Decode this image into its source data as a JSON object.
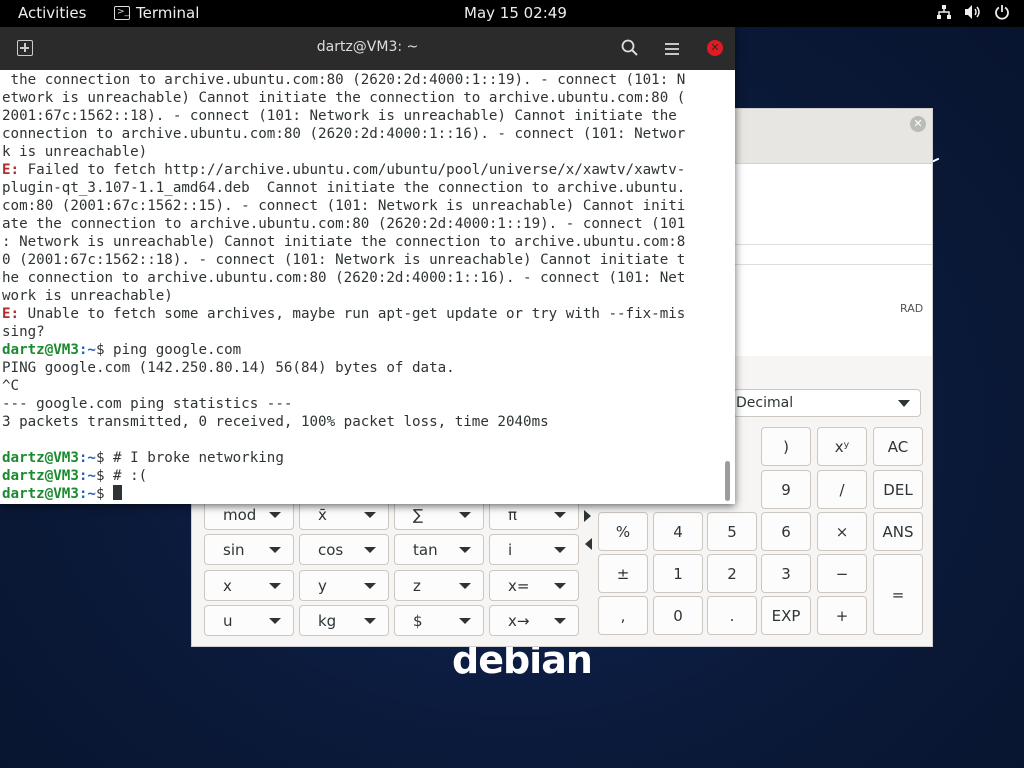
{
  "topbar": {
    "activities": "Activities",
    "app_name": "Terminal",
    "clock": "May 15  02:49"
  },
  "desktop": {
    "logo_text": "debian"
  },
  "terminal": {
    "title": "dartz@VM3: ~",
    "lines": [
      {
        "type": "text",
        "text": " the connection to archive.ubuntu.com:80 (2620:2d:4000:1::19). - connect (101: N"
      },
      {
        "type": "text",
        "text": "etwork is unreachable) Cannot initiate the connection to archive.ubuntu.com:80 ("
      },
      {
        "type": "text",
        "text": "2001:67c:1562::18). - connect (101: Network is unreachable) Cannot initiate the"
      },
      {
        "type": "text",
        "text": "connection to archive.ubuntu.com:80 (2620:2d:4000:1::16). - connect (101: Networ"
      },
      {
        "type": "text",
        "text": "k is unreachable)"
      },
      {
        "type": "error",
        "prefix": "E:",
        "text": " Failed to fetch http://archive.ubuntu.com/ubuntu/pool/universe/x/xawtv/xawtv-"
      },
      {
        "type": "text",
        "text": "plugin-qt_3.107-1.1_amd64.deb  Cannot initiate the connection to archive.ubuntu."
      },
      {
        "type": "text",
        "text": "com:80 (2001:67c:1562::15). - connect (101: Network is unreachable) Cannot initi"
      },
      {
        "type": "text",
        "text": "ate the connection to archive.ubuntu.com:80 (2620:2d:4000:1::19). - connect (101"
      },
      {
        "type": "text",
        "text": ": Network is unreachable) Cannot initiate the connection to archive.ubuntu.com:8"
      },
      {
        "type": "text",
        "text": "0 (2001:67c:1562::18). - connect (101: Network is unreachable) Cannot initiate t"
      },
      {
        "type": "text",
        "text": "he connection to archive.ubuntu.com:80 (2620:2d:4000:1::16). - connect (101: Net"
      },
      {
        "type": "text",
        "text": "work is unreachable)"
      },
      {
        "type": "error",
        "prefix": "E:",
        "text": " Unable to fetch some archives, maybe run apt-get update or try with --fix-mis"
      },
      {
        "type": "text",
        "text": "sing?"
      },
      {
        "type": "prompt",
        "user": "dartz@VM3",
        "path": ":~",
        "text": "$ ping google.com"
      },
      {
        "type": "text",
        "text": "PING google.com (142.250.80.14) 56(84) bytes of data."
      },
      {
        "type": "text",
        "text": "^C"
      },
      {
        "type": "text",
        "text": "--- google.com ping statistics ---"
      },
      {
        "type": "text",
        "text": "3 packets transmitted, 0 received, 100% packet loss, time 2040ms"
      },
      {
        "type": "text",
        "text": ""
      },
      {
        "type": "prompt",
        "user": "dartz@VM3",
        "path": ":~",
        "text": "$ # I broke networking"
      },
      {
        "type": "prompt",
        "user": "dartz@VM3",
        "path": ":~",
        "text": "$ # :("
      },
      {
        "type": "prompt-cursor",
        "user": "dartz@VM3",
        "path": ":~",
        "text": "$ "
      }
    ]
  },
  "calculator": {
    "angle_unit": "RAD",
    "mode": "Decimal",
    "function_buttons": [
      {
        "label": "mod",
        "name": "mod-button"
      },
      {
        "label": "x̄",
        "name": "mean-button"
      },
      {
        "label": "∑",
        "name": "sum-button"
      },
      {
        "label": "π",
        "name": "pi-button"
      },
      {
        "label": "sin",
        "name": "sin-button"
      },
      {
        "label": "cos",
        "name": "cos-button"
      },
      {
        "label": "tan",
        "name": "tan-button"
      },
      {
        "label": "i",
        "name": "imaginary-button"
      },
      {
        "label": "x",
        "name": "var-x-button"
      },
      {
        "label": "y",
        "name": "var-y-button"
      },
      {
        "label": "z",
        "name": "var-z-button"
      },
      {
        "label": "x=",
        "name": "assign-button"
      },
      {
        "label": "u",
        "name": "unit-button"
      },
      {
        "label": "kg",
        "name": "kg-button"
      },
      {
        "label": "$",
        "name": "currency-button"
      },
      {
        "label": "x→",
        "name": "convert-button"
      }
    ],
    "keypad": [
      {
        "label": ")",
        "name": "close-paren-button"
      },
      {
        "label": "xʸ",
        "name": "power-button"
      },
      {
        "label": "AC",
        "name": "all-clear-button"
      },
      {
        "label": "9",
        "name": "digit-9-button"
      },
      {
        "label": "/",
        "name": "divide-button"
      },
      {
        "label": "DEL",
        "name": "delete-button"
      },
      {
        "label": "%",
        "name": "percent-button"
      },
      {
        "label": "4",
        "name": "digit-4-button"
      },
      {
        "label": "5",
        "name": "digit-5-button"
      },
      {
        "label": "6",
        "name": "digit-6-button"
      },
      {
        "label": "×",
        "name": "multiply-button"
      },
      {
        "label": "ANS",
        "name": "answer-button"
      },
      {
        "label": "±",
        "name": "plus-minus-button"
      },
      {
        "label": "1",
        "name": "digit-1-button"
      },
      {
        "label": "2",
        "name": "digit-2-button"
      },
      {
        "label": "3",
        "name": "digit-3-button"
      },
      {
        "label": "−",
        "name": "subtract-button"
      },
      {
        "label": "=",
        "name": "equals-button"
      },
      {
        "label": ",",
        "name": "comma-button"
      },
      {
        "label": "0",
        "name": "digit-0-button"
      },
      {
        "label": ".",
        "name": "decimal-button"
      },
      {
        "label": "EXP",
        "name": "exp-button"
      },
      {
        "label": "+",
        "name": "add-button"
      }
    ]
  }
}
